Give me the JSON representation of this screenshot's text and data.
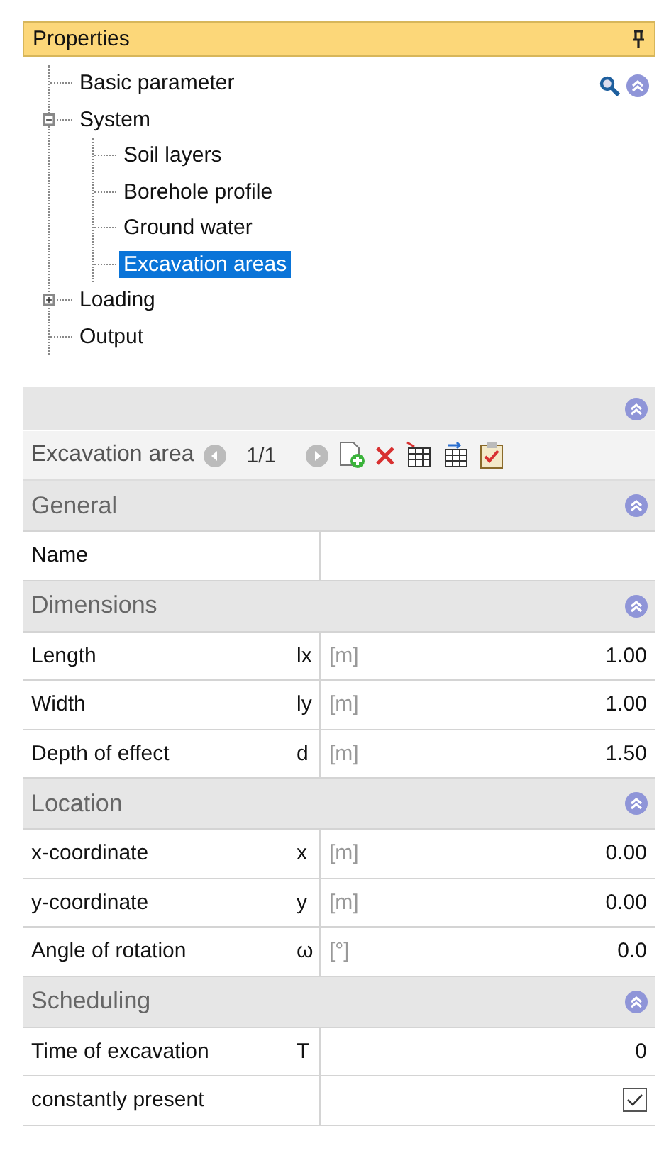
{
  "panel": {
    "title": "Properties"
  },
  "tree": [
    {
      "label": "Basic parameter",
      "selected": false
    },
    {
      "label": "System",
      "selected": false,
      "expanded": true,
      "children": [
        {
          "label": "Soil layers",
          "selected": false
        },
        {
          "label": "Borehole profile",
          "selected": false
        },
        {
          "label": "Ground water",
          "selected": false
        },
        {
          "label": "Excavation areas",
          "selected": true
        }
      ]
    },
    {
      "label": "Loading",
      "selected": false,
      "expanded": false
    },
    {
      "label": "Output",
      "selected": false
    }
  ],
  "toolbar": {
    "label": "Excavation area",
    "counter": "1/1"
  },
  "sections": [
    {
      "title": "General",
      "rows": [
        {
          "kind": "value",
          "label": "Name"
        }
      ]
    },
    {
      "title": "Dimensions",
      "rows": [
        {
          "kind": "value",
          "label": "Length",
          "symbol": "lx",
          "unit": "[m]",
          "value": "1.00"
        },
        {
          "kind": "value",
          "label": "Width",
          "symbol": "ly",
          "unit": "[m]",
          "value": "1.00"
        },
        {
          "kind": "value",
          "label": "Depth of effect",
          "symbol": "d",
          "unit": "[m]",
          "value": "1.50"
        }
      ]
    },
    {
      "title": "Location",
      "rows": [
        {
          "kind": "value",
          "label": "x-coordinate",
          "symbol": "x",
          "unit": "[m]",
          "value": "0.00"
        },
        {
          "kind": "value",
          "label": "y-coordinate",
          "symbol": "y",
          "unit": "[m]",
          "value": "0.00"
        },
        {
          "kind": "value",
          "label": "Angle of rotation",
          "symbol": "ω",
          "unit": "[°]",
          "value": "0.0"
        }
      ]
    },
    {
      "title": "Scheduling",
      "rows": [
        {
          "kind": "value",
          "label": "Time of excavation",
          "symbol": "T",
          "value": "0"
        },
        {
          "kind": "checkbox",
          "label": "constantly present",
          "checked": true
        }
      ]
    }
  ]
}
